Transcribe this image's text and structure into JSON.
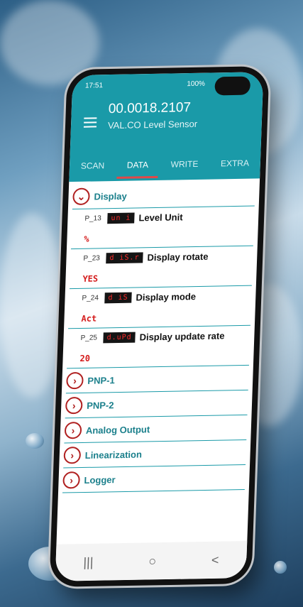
{
  "status": {
    "time": "17:51",
    "battery": "100%"
  },
  "header": {
    "title": "00.0018.2107",
    "subtitle": "VAL.CO Level Sensor"
  },
  "tabs": [
    {
      "label": "SCAN"
    },
    {
      "label": "DATA"
    },
    {
      "label": "WRITE"
    },
    {
      "label": "EXTRA"
    }
  ],
  "display_section": {
    "label": "Display",
    "params": [
      {
        "code": "P_13",
        "segment": "un i",
        "name": "Level Unit",
        "value": "%"
      },
      {
        "code": "P_23",
        "segment": "d iS.r",
        "name": "Display rotate",
        "value": "YES"
      },
      {
        "code": "P_24",
        "segment": "d iS",
        "name": "Display mode",
        "value": "Act"
      },
      {
        "code": "P_25",
        "segment": "d.uPd",
        "name": "Display update rate",
        "value": "20"
      }
    ]
  },
  "sections": [
    {
      "label": "PNP-1"
    },
    {
      "label": "PNP-2"
    },
    {
      "label": "Analog Output"
    },
    {
      "label": "Linearization"
    },
    {
      "label": "Logger"
    }
  ],
  "navbar": {
    "recent": "|||",
    "home": "○",
    "back": "<"
  }
}
